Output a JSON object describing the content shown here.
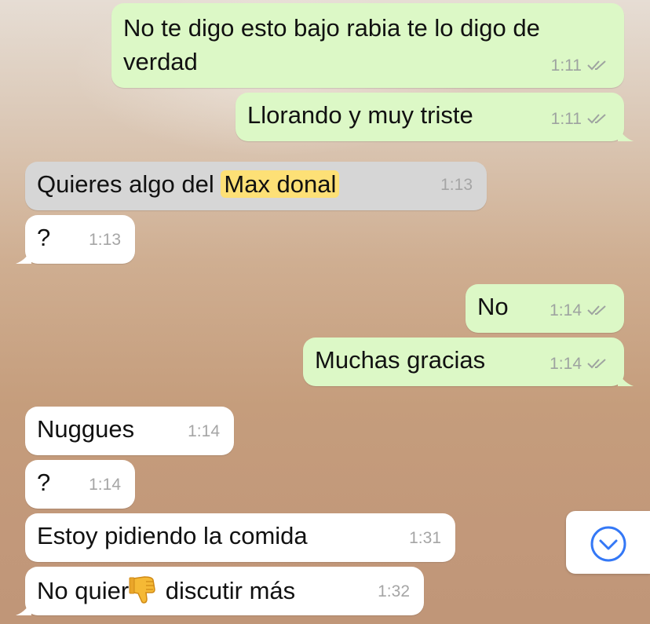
{
  "chat": {
    "messages": [
      {
        "direction": "out",
        "lines": [
          "No te digo esto bajo rabia te lo digo de",
          "verdad"
        ],
        "time": "1:11",
        "status": "read"
      },
      {
        "direction": "out",
        "text": "Llorando y muy triste",
        "time": "1:11",
        "status": "read"
      },
      {
        "direction": "in",
        "text_before": "Quieres algo del ",
        "highlight": "Max donal",
        "time": "1:13",
        "state": "selected"
      },
      {
        "direction": "in",
        "text": "?",
        "time": "1:13"
      },
      {
        "direction": "out",
        "text": "No",
        "time": "1:14",
        "status": "read"
      },
      {
        "direction": "out",
        "text": "Muchas gracias",
        "time": "1:14",
        "status": "read"
      },
      {
        "direction": "in",
        "text": "Nuggues",
        "time": "1:14"
      },
      {
        "direction": "in",
        "text": "?",
        "time": "1:14"
      },
      {
        "direction": "in",
        "text": "Estoy pidiendo la comida",
        "time": "1:31"
      },
      {
        "direction": "in",
        "text_before": "No quier",
        "emoji": "thumbs-down-emoji",
        "text_after": " discutir más",
        "time": "1:32"
      }
    ]
  },
  "colors": {
    "outgoing_bubble": "#dcf8c6",
    "incoming_bubble": "#ffffff",
    "selected_bubble": "#d6d6d6",
    "highlight": "#fde076",
    "scroll_icon": "#3478f6"
  },
  "scroll_button": {
    "icon": "chevron-down-circle-icon"
  }
}
